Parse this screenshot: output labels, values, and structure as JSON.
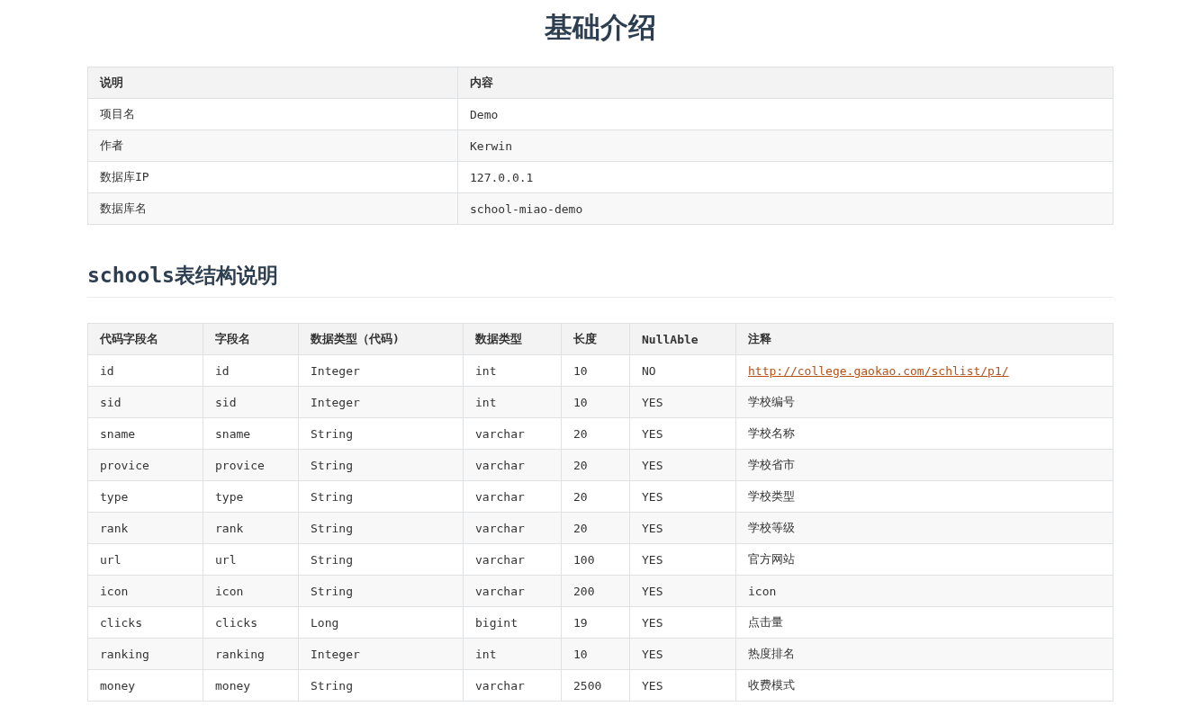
{
  "title": "基础介绍",
  "info_table": {
    "columns": [
      "说明",
      "内容"
    ],
    "rows": [
      [
        "项目名",
        "Demo"
      ],
      [
        "作者",
        "Kerwin"
      ],
      [
        "数据库IP",
        "127.0.0.1"
      ],
      [
        "数据库名",
        "school-miao-demo"
      ]
    ]
  },
  "section_heading": "schools表结构说明",
  "schema_table": {
    "columns": [
      "代码字段名",
      "字段名",
      "数据类型（代码)",
      "数据类型",
      "长度",
      "NullAble",
      "注释"
    ],
    "rows": [
      {
        "cells": [
          "id",
          "id",
          "Integer",
          "int",
          "10",
          "NO"
        ],
        "note": {
          "kind": "link",
          "text": "http://college.gaokao.com/schlist/p1/"
        }
      },
      {
        "cells": [
          "sid",
          "sid",
          "Integer",
          "int",
          "10",
          "YES"
        ],
        "note": {
          "kind": "text",
          "text": "学校编号"
        }
      },
      {
        "cells": [
          "sname",
          "sname",
          "String",
          "varchar",
          "20",
          "YES"
        ],
        "note": {
          "kind": "text",
          "text": "学校名称"
        }
      },
      {
        "cells": [
          "provice",
          "provice",
          "String",
          "varchar",
          "20",
          "YES"
        ],
        "note": {
          "kind": "text",
          "text": "学校省市"
        }
      },
      {
        "cells": [
          "type",
          "type",
          "String",
          "varchar",
          "20",
          "YES"
        ],
        "note": {
          "kind": "text",
          "text": "学校类型"
        }
      },
      {
        "cells": [
          "rank",
          "rank",
          "String",
          "varchar",
          "20",
          "YES"
        ],
        "note": {
          "kind": "text",
          "text": "学校等级"
        }
      },
      {
        "cells": [
          "url",
          "url",
          "String",
          "varchar",
          "100",
          "YES"
        ],
        "note": {
          "kind": "text",
          "text": "官方网站"
        }
      },
      {
        "cells": [
          "icon",
          "icon",
          "String",
          "varchar",
          "200",
          "YES"
        ],
        "note": {
          "kind": "text",
          "text": "icon"
        }
      },
      {
        "cells": [
          "clicks",
          "clicks",
          "Long",
          "bigint",
          "19",
          "YES"
        ],
        "note": {
          "kind": "text",
          "text": "点击量"
        }
      },
      {
        "cells": [
          "ranking",
          "ranking",
          "Integer",
          "int",
          "10",
          "YES"
        ],
        "note": {
          "kind": "text",
          "text": "热度排名"
        }
      },
      {
        "cells": [
          "money",
          "money",
          "String",
          "varchar",
          "2500",
          "YES"
        ],
        "note": {
          "kind": "text",
          "text": "收费模式"
        }
      }
    ]
  }
}
